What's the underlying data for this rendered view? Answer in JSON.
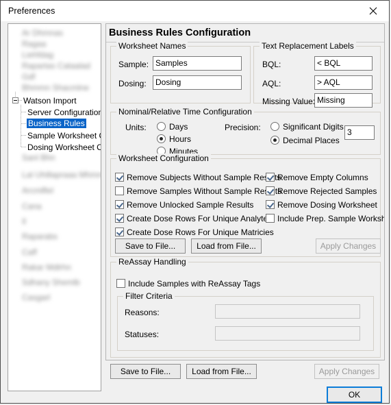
{
  "window": {
    "title": "Preferences",
    "close_icon": "close-icon"
  },
  "sidebar": {
    "blurred_items_top": [
      "Ar Dhmnas",
      "Ragaa",
      "Liehfdag",
      "Rapartas Cataalad",
      "Gdf",
      "Bhmmn Shacmlne"
    ],
    "tree_root": "Watson Import",
    "tree_children": [
      "Server Configuration",
      "Business Rules",
      "Sample Worksheet C",
      "Dosing Worksheet C"
    ],
    "selected": "Business Rules",
    "blurred_items_bottom": [
      "Sanl Bhn",
      "Lal Uhillapraaa Mhmrn",
      "Arcmlflel",
      "Cana",
      "Il",
      "Raparabs",
      "Caff",
      "Rakar Mdlrhn",
      "Sdhany Shemlb",
      "Casgarl"
    ]
  },
  "main": {
    "page_title": "Business Rules Configuration",
    "worksheet_names": {
      "legend": "Worksheet Names",
      "sample_label": "Sample:",
      "sample_value": "Samples",
      "dosing_label": "Dosing:",
      "dosing_value": "Dosing"
    },
    "text_replacement": {
      "legend": "Text Replacement Labels",
      "bql_label": "BQL:",
      "bql_value": "< BQL",
      "aql_label": "AQL:",
      "aql_value": "> AQL",
      "missing_label": "Missing Value:",
      "missing_value": "Missing"
    },
    "time_config": {
      "legend": "Nominal/Relative Time Configuration",
      "units_label": "Units:",
      "units_options": [
        "Days",
        "Hours",
        "Minutes"
      ],
      "units_selected": "Hours",
      "precision_label": "Precision:",
      "precision_options": [
        "Significant Digits",
        "Decimal Places"
      ],
      "precision_selected": "Decimal Places",
      "precision_value": "3"
    },
    "worksheet_config": {
      "legend": "Worksheet Configuration",
      "left_column": [
        {
          "label": "Remove Subjects Without Sample Results",
          "checked": true
        },
        {
          "label": "Remove Samples Without Sample Results",
          "checked": false
        },
        {
          "label": "Remove Unlocked Sample Results",
          "checked": true
        },
        {
          "label": "Create Dose Rows For Unique Analytes",
          "checked": true
        },
        {
          "label": "Create Dose Rows For Unique Matricies",
          "checked": true
        }
      ],
      "right_column": [
        {
          "label": "Remove Empty Columns",
          "checked": true
        },
        {
          "label": "Remove Rejected Samples",
          "checked": true
        },
        {
          "label": "Remove Dosing Worksheet",
          "checked": true
        },
        {
          "label": "Include Prep. Sample Worksheet",
          "checked": false
        }
      ]
    },
    "actions_upper": {
      "save_label": "Save to File...",
      "load_label": "Load from File...",
      "apply_label": "Apply Changes",
      "apply_enabled": false
    },
    "reassay": {
      "legend": "ReAssay Handling",
      "include_label": "Include Samples with ReAssay Tags",
      "include_checked": false,
      "filter_legend": "Filter Criteria",
      "reasons_label": "Reasons:",
      "reasons_value": "",
      "statuses_label": "Statuses:",
      "statuses_value": ""
    }
  },
  "footer": {
    "save_label": "Save to File...",
    "load_label": "Load from File...",
    "apply_label": "Apply Changes",
    "apply_enabled": false,
    "ok_label": "OK"
  },
  "colors": {
    "selection_blue": "#0a64c8",
    "focus_blue": "#0a7cd8",
    "window_bg": "#f0f0f0",
    "check_mark": "#49678c"
  }
}
